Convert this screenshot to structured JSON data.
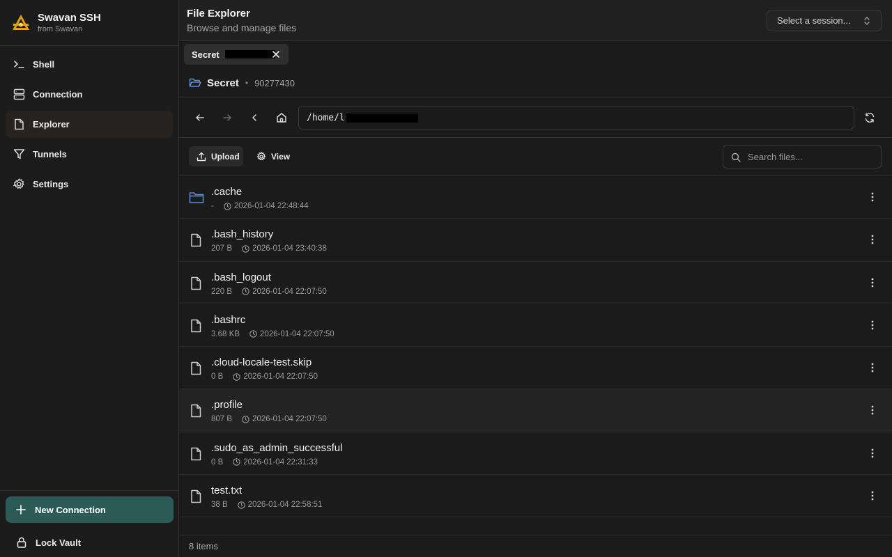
{
  "brand": {
    "name": "Swavan SSH",
    "sub": "from Swavan"
  },
  "nav": [
    {
      "label": "Shell",
      "icon": "terminal-icon"
    },
    {
      "label": "Connection",
      "icon": "server-icon"
    },
    {
      "label": "Explorer",
      "icon": "file-icon",
      "active": true
    },
    {
      "label": "Tunnels",
      "icon": "filter-icon"
    },
    {
      "label": "Settings",
      "icon": "gear-icon"
    }
  ],
  "sidebar_bottom": {
    "new_connection": "New Connection",
    "lock_vault": "Lock Vault"
  },
  "header": {
    "title": "File Explorer",
    "subtitle": "Browse and manage files",
    "session_placeholder": "Select a session..."
  },
  "tab": {
    "label": "Secret"
  },
  "session": {
    "name": "Secret",
    "separator": "•",
    "id": "90277430"
  },
  "path": {
    "value": "/home/l"
  },
  "toolbar": {
    "upload": "Upload",
    "view": "View",
    "search_placeholder": "Search files..."
  },
  "files": [
    {
      "name": ".cache",
      "size": "-",
      "modified": "2026-01-04 22:48:44",
      "type": "folder"
    },
    {
      "name": ".bash_history",
      "size": "207 B",
      "modified": "2026-01-04 23:40:38",
      "type": "file"
    },
    {
      "name": ".bash_logout",
      "size": "220 B",
      "modified": "2026-01-04 22:07:50",
      "type": "file"
    },
    {
      "name": ".bashrc",
      "size": "3.68 KB",
      "modified": "2026-01-04 22:07:50",
      "type": "file"
    },
    {
      "name": ".cloud-locale-test.skip",
      "size": "0 B",
      "modified": "2026-01-04 22:07:50",
      "type": "file"
    },
    {
      "name": ".profile",
      "size": "807 B",
      "modified": "2026-01-04 22:07:50",
      "type": "file"
    },
    {
      "name": ".sudo_as_admin_successful",
      "size": "0 B",
      "modified": "2026-01-04 22:31:33",
      "type": "file"
    },
    {
      "name": "test.txt",
      "size": "38 B",
      "modified": "2026-01-04 22:58:51",
      "type": "file"
    }
  ],
  "footer": {
    "count": "8 items"
  },
  "colors": {
    "accent": "#2c5a57",
    "folder": "#5b8fd8",
    "background": "#1b1b1b"
  }
}
